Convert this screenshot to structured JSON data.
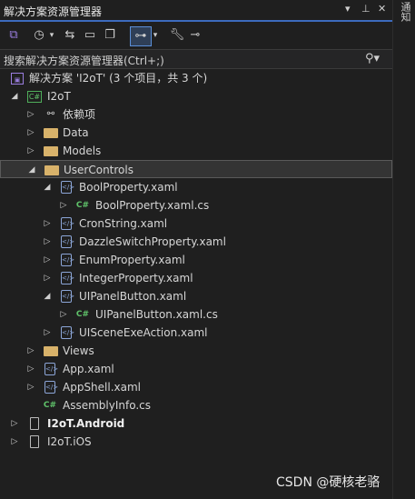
{
  "window": {
    "title": "解决方案资源管理器"
  },
  "search": {
    "placeholder": "搜索解决方案资源管理器(Ctrl+;)"
  },
  "tree": {
    "solution": "解决方案 'I2oT' (3 个项目，共 3 个)",
    "project_main": "I2oT",
    "dependencies": "依赖项",
    "data_folder": "Data",
    "models_folder": "Models",
    "usercontrols_folder": "UserControls",
    "boolproperty_xaml": "BoolProperty.xaml",
    "boolproperty_cs": "BoolProperty.xaml.cs",
    "cronstring_xaml": "CronString.xaml",
    "dazzle_xaml": "DazzleSwitchProperty.xaml",
    "enum_xaml": "EnumProperty.xaml",
    "integer_xaml": "IntegerProperty.xaml",
    "uipanel_xaml": "UIPanelButton.xaml",
    "uipanel_cs": "UIPanelButton.xaml.cs",
    "uiscene_xaml": "UISceneExeAction.xaml",
    "views_folder": "Views",
    "app_xaml": "App.xaml",
    "appshell_xaml": "AppShell.xaml",
    "assemblyinfo": "AssemblyInfo.cs",
    "project_android": "I2oT.Android",
    "project_ios": "I2oT.iOS"
  },
  "side_panel": {
    "label": "通知"
  },
  "watermark": "CSDN @硬核老骆",
  "colors": {
    "accent": "#3c6bbd",
    "folder": "#d8b26a",
    "csharp": "#5fc26a"
  }
}
